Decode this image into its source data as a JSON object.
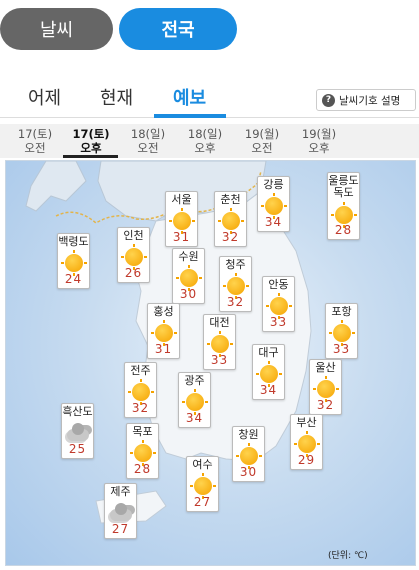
{
  "top_pills": {
    "weather": "날씨",
    "nation": "전국"
  },
  "tabs": {
    "yesterday": "어제",
    "now": "현재",
    "forecast": "예보"
  },
  "help_button": {
    "icon": "question-icon",
    "q": "?",
    "label": "날씨기호 설명"
  },
  "times": [
    {
      "date": "17(토)",
      "period": "오전",
      "active": false
    },
    {
      "date": "17(토)",
      "period": "오후",
      "active": true
    },
    {
      "date": "18(일)",
      "period": "오전",
      "active": false
    },
    {
      "date": "18(일)",
      "period": "오후",
      "active": false
    },
    {
      "date": "19(월)",
      "period": "오전",
      "active": false
    },
    {
      "date": "19(월)",
      "period": "오후",
      "active": false
    }
  ],
  "cities": [
    {
      "name": "서울",
      "temp": "31",
      "icon": "sun-icon"
    },
    {
      "name": "춘천",
      "temp": "32",
      "icon": "sun-icon"
    },
    {
      "name": "강릉",
      "temp": "34",
      "icon": "sun-icon"
    },
    {
      "name": "울릉도 독도",
      "name1": "울릉도",
      "name2": "독도",
      "temp": "28",
      "icon": "sun-icon"
    },
    {
      "name": "백령도",
      "temp": "24",
      "icon": "sun-icon"
    },
    {
      "name": "인천",
      "temp": "26",
      "icon": "sun-icon"
    },
    {
      "name": "수원",
      "temp": "30",
      "icon": "sun-icon"
    },
    {
      "name": "청주",
      "temp": "32",
      "icon": "sun-icon"
    },
    {
      "name": "안동",
      "temp": "33",
      "icon": "sun-icon"
    },
    {
      "name": "홍성",
      "temp": "31",
      "icon": "sun-icon"
    },
    {
      "name": "대전",
      "temp": "33",
      "icon": "sun-icon"
    },
    {
      "name": "포항",
      "temp": "33",
      "icon": "sun-icon"
    },
    {
      "name": "대구",
      "temp": "34",
      "icon": "sun-icon"
    },
    {
      "name": "전주",
      "temp": "32",
      "icon": "sun-icon"
    },
    {
      "name": "광주",
      "temp": "34",
      "icon": "sun-icon"
    },
    {
      "name": "울산",
      "temp": "32",
      "icon": "sun-icon"
    },
    {
      "name": "흑산도",
      "temp": "25",
      "icon": "cloud-icon"
    },
    {
      "name": "목포",
      "temp": "28",
      "icon": "partly-cloudy-icon"
    },
    {
      "name": "창원",
      "temp": "30",
      "icon": "sun-icon"
    },
    {
      "name": "부산",
      "temp": "29",
      "icon": "sun-icon"
    },
    {
      "name": "여수",
      "temp": "27",
      "icon": "sun-icon"
    },
    {
      "name": "제주",
      "temp": "27",
      "icon": "cloud-icon"
    }
  ],
  "unit_label": "(단위: ℃)"
}
